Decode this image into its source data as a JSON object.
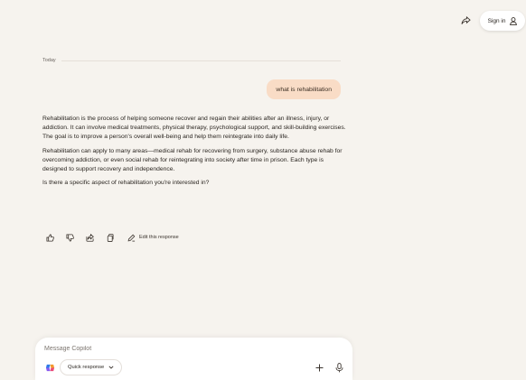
{
  "header": {
    "share_icon": "share-icon",
    "signin_label": "Sign in",
    "signin_icon": "user-icon"
  },
  "conversation": {
    "date_label": "Today",
    "user_message": "what is rehabilitation",
    "reply_paragraphs": [
      "Rehabilitation is the process of helping someone recover and regain their abilities after an illness, injury, or addiction. It can involve medical treatments, physical therapy, psychological support, and skill-building exercises. The goal is to improve a person's overall well-being and help them reintegrate into daily life.",
      "Rehabilitation can apply to many areas—medical rehab for recovering from surgery, substance abuse rehab for overcoming addiction, or even social rehab for reintegrating into society after time in prison. Each type is designed to support recovery and independence.",
      "Is there a specific aspect of rehabilitation you're interested in?"
    ],
    "actions": {
      "icons": [
        "thumbs-up-icon",
        "thumbs-down-icon",
        "share-icon",
        "copy-icon"
      ],
      "edit_label": "Edit this response"
    }
  },
  "composer": {
    "placeholder": "Message Copilot",
    "value": "",
    "mode_label": "Quick response",
    "colors": {
      "accent": "#f9dcc6",
      "background": "#f6f3ee"
    }
  }
}
